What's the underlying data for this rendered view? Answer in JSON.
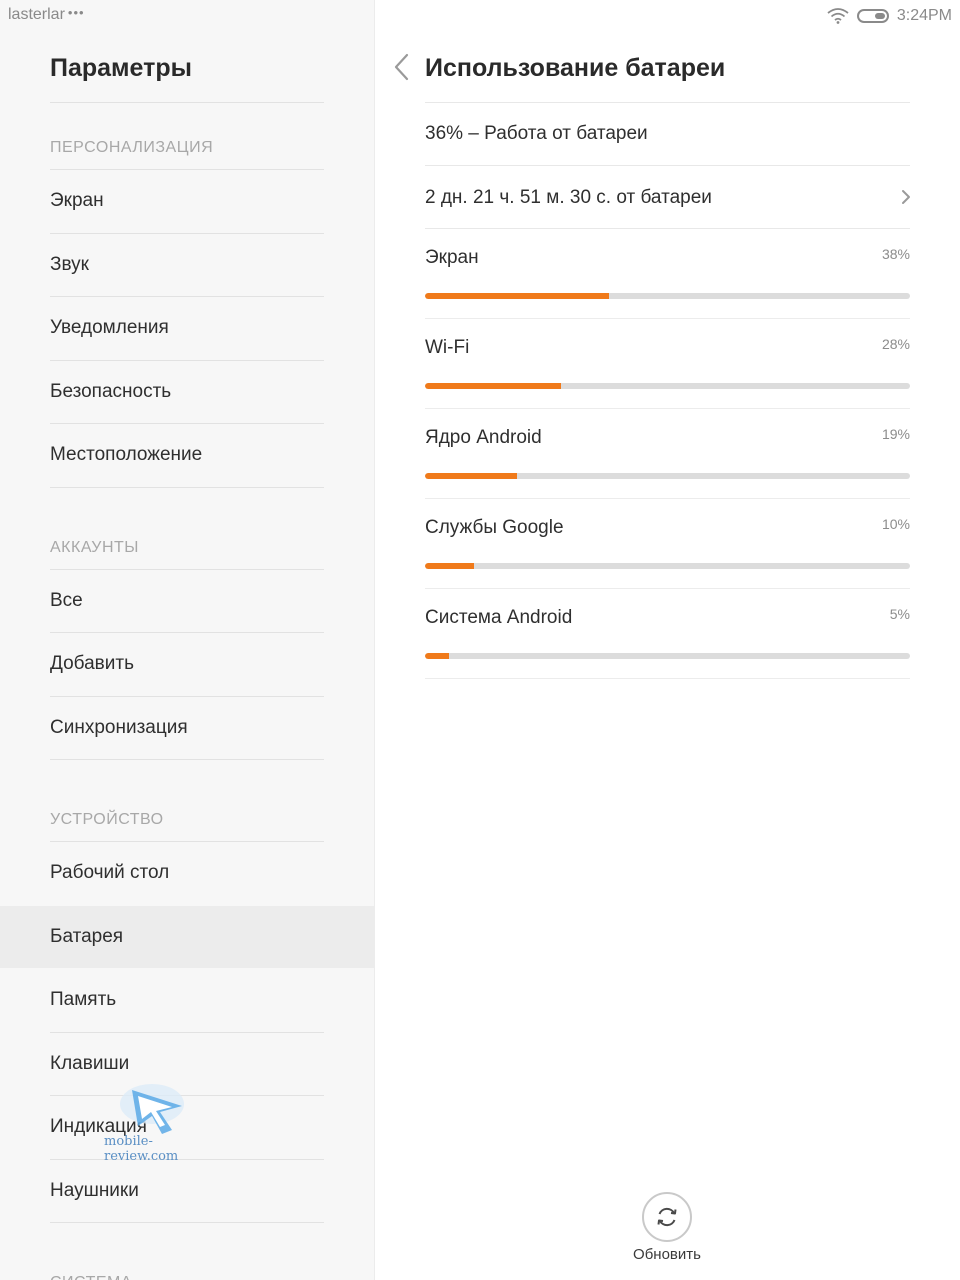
{
  "status_bar": {
    "carrier": "lasterlar",
    "carrier_dots": "•••",
    "time": "3:24PM",
    "wifi_icon": "wifi-icon",
    "battery_icon": "battery-icon"
  },
  "sidebar": {
    "title": "Параметры",
    "sections": [
      {
        "header": "ПЕРСОНАЛИЗАЦИЯ",
        "items": [
          "Экран",
          "Звук",
          "Уведомления",
          "Безопасность",
          "Местоположение"
        ]
      },
      {
        "header": "АККАУНТЫ",
        "items": [
          "Все",
          "Добавить",
          "Синхронизация"
        ]
      },
      {
        "header": "УСТРОЙСТВО",
        "items": [
          "Рабочий стол",
          "Батарея",
          "Память",
          "Клавиши",
          "Индикация",
          "Наушники"
        ]
      },
      {
        "header": "СИСТЕМА",
        "items": []
      }
    ],
    "active_item": "Батарея"
  },
  "watermark": {
    "text": "mobile-review.com"
  },
  "main": {
    "title": "Использование батареи",
    "back_icon": "chevron-left-icon",
    "battery_level": "36% – Работа от батареи",
    "on_battery_time": "2 дн. 21 ч. 51 м. 30 с. от батареи",
    "usage": [
      {
        "name": "Экран",
        "percent_label": "38%",
        "percent": 38
      },
      {
        "name": "Wi-Fi",
        "percent_label": "28%",
        "percent": 28
      },
      {
        "name": "Ядро Android",
        "percent_label": "19%",
        "percent": 19
      },
      {
        "name": "Службы Google",
        "percent_label": "10%",
        "percent": 10
      },
      {
        "name": "Система Android",
        "percent_label": "5%",
        "percent": 5
      }
    ],
    "accent_color": "#f07a1a",
    "refresh_label": "Обновить",
    "refresh_icon": "refresh-icon"
  }
}
